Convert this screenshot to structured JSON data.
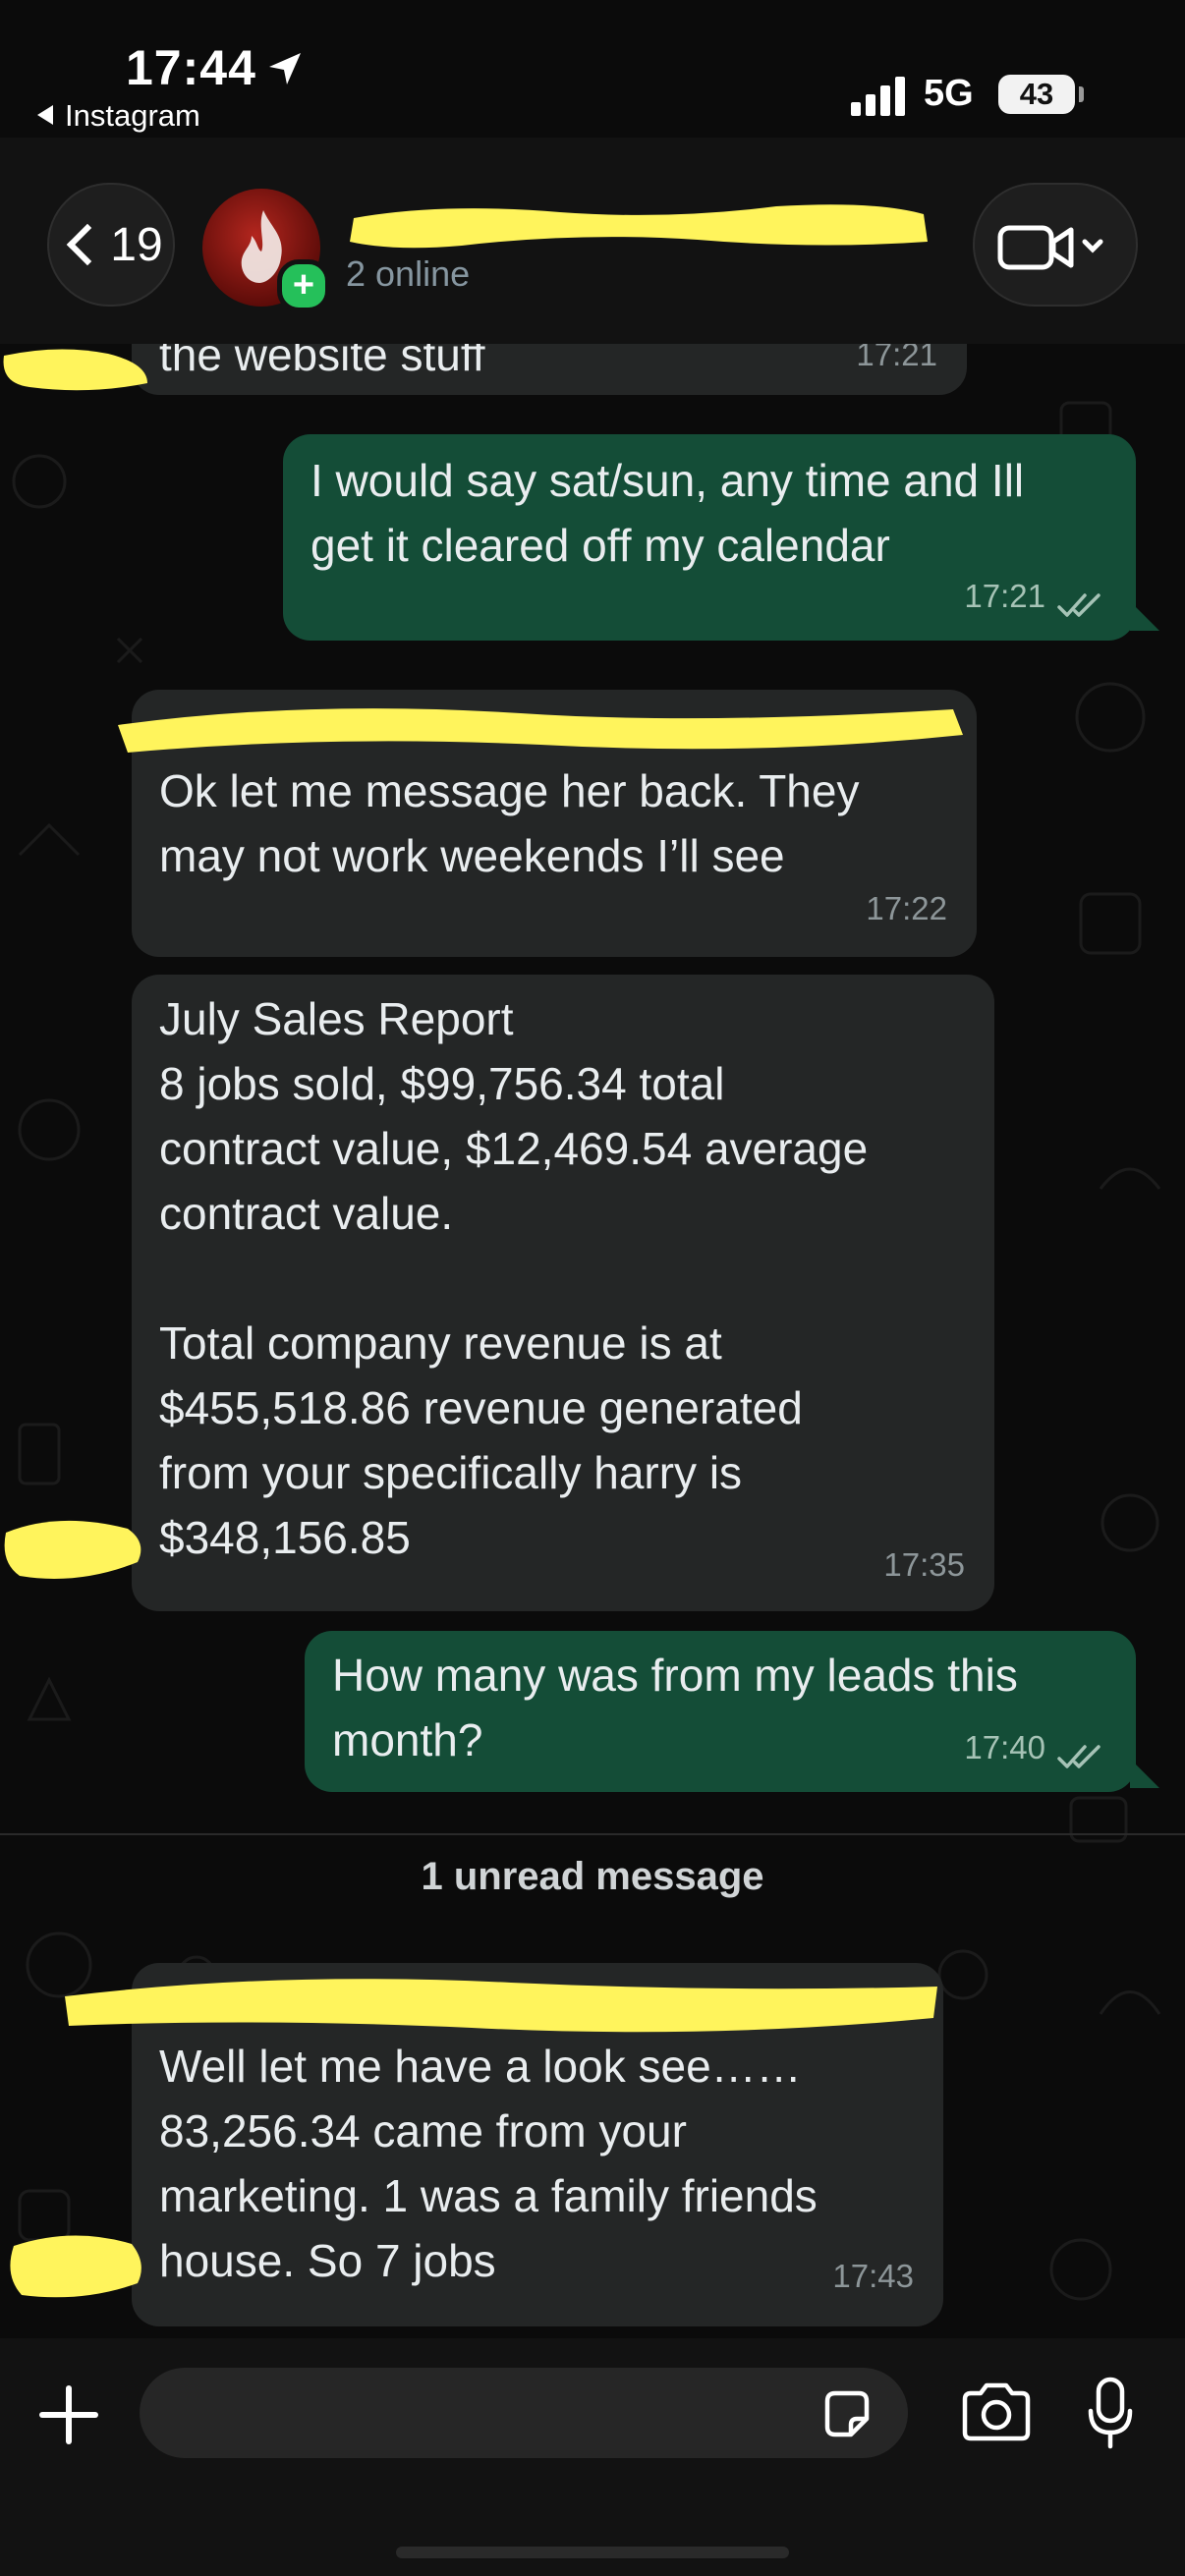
{
  "status_bar": {
    "time": "17:44",
    "back_app": "Instagram",
    "network": "5G",
    "battery": "43"
  },
  "header": {
    "back_count": "19",
    "subtitle": "2 online",
    "plus_badge": "+"
  },
  "messages": [
    {
      "dir": "in",
      "text": "the website stuff",
      "time": "17:21"
    },
    {
      "dir": "out",
      "text": "I would say sat/sun, any time and Ill\nget it cleared off my calendar",
      "time": "17:21",
      "read": true
    },
    {
      "dir": "in",
      "text": "Ok let me message her back. They\nmay not work weekends I’ll see",
      "time": "17:22"
    },
    {
      "dir": "in",
      "text": "July Sales Report\n8 jobs sold, $99,756.34 total\ncontract value, $12,469.54 average\ncontract value.\n\nTotal company revenue is at\n$455,518.86 revenue generated\nfrom your specifically harry is\n$348,156.85",
      "time": "17:35"
    },
    {
      "dir": "out",
      "text": "How many was from my leads this\nmonth?",
      "time": "17:40",
      "read": true
    },
    {
      "dir": "in",
      "text": "Well let me have a look see……\n83,256.34 came from your\nmarketing. 1 was a family friends\nhouse. So 7 jobs",
      "time": "17:43"
    }
  ],
  "unread_divider": "1 unread message",
  "input": {
    "value": "",
    "placeholder": ""
  },
  "colors": {
    "incoming": "#242626",
    "outgoing": "#144d37",
    "redaction": "#fff45c",
    "read_ticks": "#a6c3b6"
  }
}
